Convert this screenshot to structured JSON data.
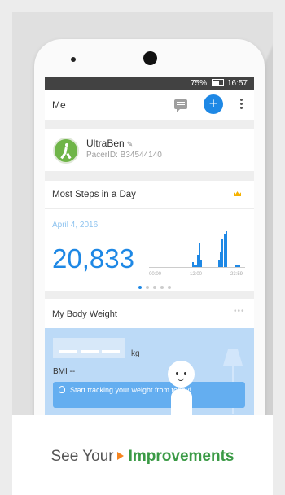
{
  "status": {
    "battery": "75%",
    "time": "16:57"
  },
  "appbar": {
    "title": "Me"
  },
  "profile": {
    "name": "UltraBen",
    "pacer_id": "PacerID: B34544140"
  },
  "steps": {
    "title": "Most Steps in a Day",
    "date": "April 4, 2016",
    "count": "20,833",
    "ticks": [
      "00:00",
      "12:00",
      "23:59"
    ],
    "chart_data": {
      "type": "bar",
      "title": "",
      "xlabel": "",
      "ylabel": "",
      "ticks": [
        "00:00",
        "12:00",
        "23:59"
      ],
      "values": [
        0,
        0,
        0,
        0,
        0,
        0,
        0,
        0,
        0,
        0,
        0,
        0,
        0,
        0,
        0,
        0,
        0,
        0,
        0,
        0,
        0,
        0,
        0,
        0,
        0,
        0,
        0,
        2,
        1,
        1,
        5,
        10,
        3,
        0,
        0,
        0,
        0,
        0,
        0,
        0,
        0,
        0,
        0,
        3,
        6,
        12,
        0,
        14,
        15,
        0,
        0,
        0,
        0,
        0,
        1,
        1,
        1,
        0,
        0,
        0
      ]
    },
    "page_dots": 5,
    "active_dot": 0
  },
  "weight": {
    "title": "My Body Weight",
    "more": "•••",
    "unit": "kg",
    "bmi": "BMI --",
    "tip": "Start tracking your weight from today!"
  },
  "caption": {
    "prefix": "See Your",
    "highlight": "Improvements"
  },
  "colors": {
    "accent": "#1e88e5",
    "green": "#3a9a45",
    "orange": "#f5841f"
  }
}
